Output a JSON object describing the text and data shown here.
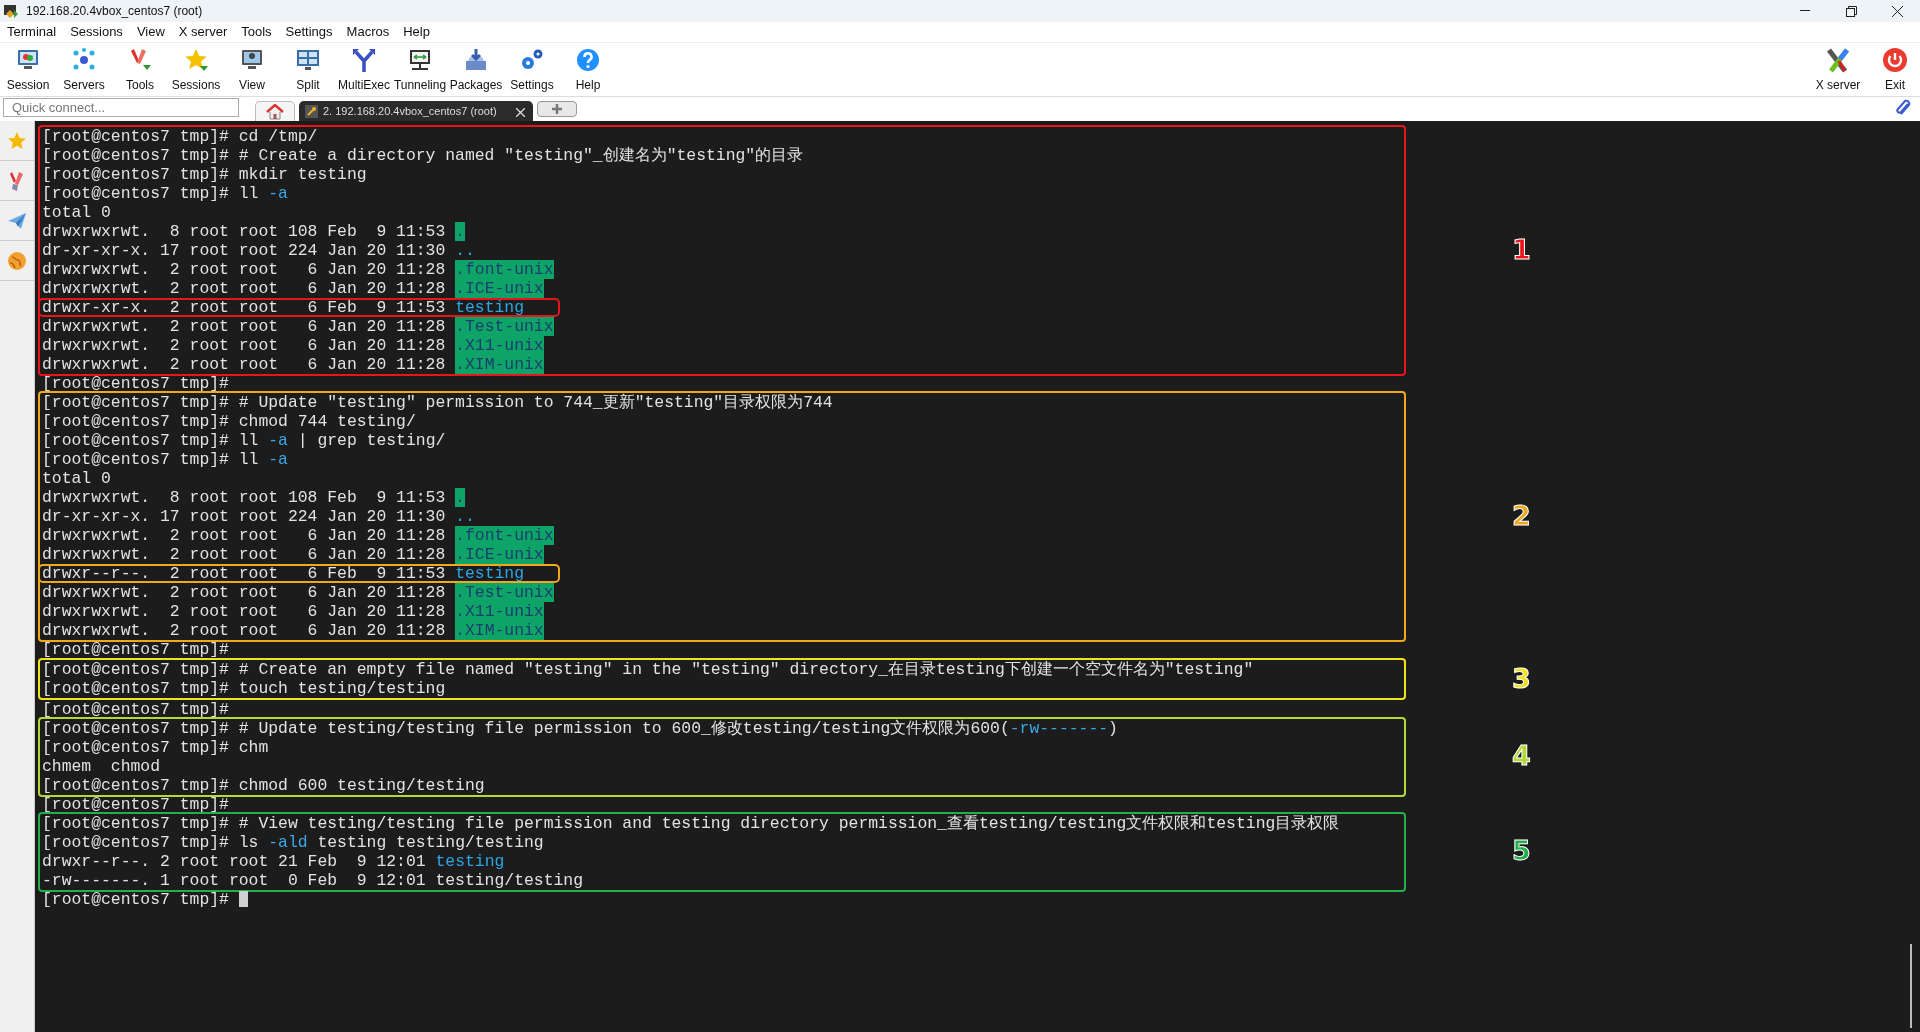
{
  "window": {
    "title": "192.168.20.4vbox_centos7 (root)"
  },
  "menu": [
    "Terminal",
    "Sessions",
    "View",
    "X server",
    "Tools",
    "Settings",
    "Macros",
    "Help"
  ],
  "toolbar": {
    "left": [
      "Session",
      "Servers",
      "Tools",
      "Sessions",
      "View",
      "Split",
      "MultiExec",
      "Tunneling",
      "Packages",
      "Settings",
      "Help"
    ],
    "right": [
      "X server",
      "Exit"
    ]
  },
  "quick_connect": {
    "placeholder": "Quick connect..."
  },
  "tabs": [
    {
      "kind": "home",
      "selected": false
    },
    {
      "kind": "session",
      "label": "2. 192.168.20.4vbox_centos7 (root)",
      "selected": true
    }
  ],
  "terminal": {
    "blocks": [
      {
        "box": {
          "color": "#e8161c",
          "number": "1"
        },
        "lines": [
          {
            "parts": [
              {
                "kind": "text",
                "text": "[root@centos7 tmp]# cd /tmp/"
              }
            ]
          },
          {
            "parts": [
              {
                "kind": "text",
                "text": "[root@centos7 tmp]# # Create a directory named \"testing\"_创建名为\"testing\"的目录"
              }
            ]
          },
          {
            "parts": [
              {
                "kind": "text",
                "text": "[root@centos7 tmp]# mkdir testing"
              }
            ]
          },
          {
            "parts": [
              {
                "kind": "text",
                "text": "[root@centos7 tmp]# ll "
              },
              {
                "kind": "option",
                "text": "-a"
              }
            ]
          },
          {
            "parts": [
              {
                "kind": "text",
                "text": "total 0"
              }
            ]
          },
          {
            "parts": [
              {
                "kind": "text",
                "text": "drwxrwxrwt.  8 root root 108 Feb  9 11:53 "
              },
              {
                "kind": "sticky",
                "text": "."
              }
            ]
          },
          {
            "parts": [
              {
                "kind": "text",
                "text": "dr-xr-xr-x. 17 root root 224 Jan 20 11:30 "
              },
              {
                "kind": "dir",
                "text": ".."
              }
            ]
          },
          {
            "parts": [
              {
                "kind": "text",
                "text": "drwxrwxrwt.  2 root root   6 Jan 20 11:28 "
              },
              {
                "kind": "sticky",
                "text": ".font-unix"
              }
            ]
          },
          {
            "parts": [
              {
                "kind": "text",
                "text": "drwxrwxrwt.  2 root root   6 Jan 20 11:28 "
              },
              {
                "kind": "sticky",
                "text": ".ICE-unix"
              }
            ]
          },
          {
            "highlight": true,
            "parts": [
              {
                "kind": "text",
                "text": "drwxr-xr-x.  2 root root   6 Feb  9 11:53 "
              },
              {
                "kind": "dir",
                "text": "testing"
              }
            ]
          },
          {
            "parts": [
              {
                "kind": "text",
                "text": "drwxrwxrwt.  2 root root   6 Jan 20 11:28 "
              },
              {
                "kind": "sticky",
                "text": ".Test-unix"
              }
            ]
          },
          {
            "parts": [
              {
                "kind": "text",
                "text": "drwxrwxrwt.  2 root root   6 Jan 20 11:28 "
              },
              {
                "kind": "sticky",
                "text": ".X11-unix"
              }
            ]
          },
          {
            "parts": [
              {
                "kind": "text",
                "text": "drwxrwxrwt.  2 root root   6 Jan 20 11:28 "
              },
              {
                "kind": "sticky",
                "text": ".XIM-unix"
              }
            ]
          }
        ]
      },
      {
        "lines": [
          {
            "parts": [
              {
                "kind": "text",
                "text": "[root@centos7 tmp]#"
              }
            ]
          }
        ]
      },
      {
        "box": {
          "color": "#f0a81c",
          "number": "2"
        },
        "lines": [
          {
            "parts": [
              {
                "kind": "text",
                "text": "[root@centos7 tmp]# # Update \"testing\" permission to 744_更新\"testing\"目录权限为744"
              }
            ]
          },
          {
            "parts": [
              {
                "kind": "text",
                "text": "[root@centos7 tmp]# chmod 744 testing/"
              }
            ]
          },
          {
            "parts": [
              {
                "kind": "text",
                "text": "[root@centos7 tmp]# ll "
              },
              {
                "kind": "option",
                "text": "-a"
              },
              {
                "kind": "text",
                "text": " | grep testing/"
              }
            ]
          },
          {
            "parts": [
              {
                "kind": "text",
                "text": "[root@centos7 tmp]# ll "
              },
              {
                "kind": "option",
                "text": "-a"
              }
            ]
          },
          {
            "parts": [
              {
                "kind": "text",
                "text": "total 0"
              }
            ]
          },
          {
            "parts": [
              {
                "kind": "text",
                "text": "drwxrwxrwt.  8 root root 108 Feb  9 11:53 "
              },
              {
                "kind": "sticky",
                "text": "."
              }
            ]
          },
          {
            "parts": [
              {
                "kind": "text",
                "text": "dr-xr-xr-x. 17 root root 224 Jan 20 11:30 "
              },
              {
                "kind": "dir",
                "text": ".."
              }
            ]
          },
          {
            "parts": [
              {
                "kind": "text",
                "text": "drwxrwxrwt.  2 root root   6 Jan 20 11:28 "
              },
              {
                "kind": "sticky",
                "text": ".font-unix"
              }
            ]
          },
          {
            "parts": [
              {
                "kind": "text",
                "text": "drwxrwxrwt.  2 root root   6 Jan 20 11:28 "
              },
              {
                "kind": "sticky",
                "text": ".ICE-unix"
              }
            ]
          },
          {
            "highlight": true,
            "parts": [
              {
                "kind": "text",
                "text": "drwxr--r--.  2 root root   6 Feb  9 11:53 "
              },
              {
                "kind": "dir",
                "text": "testing"
              }
            ]
          },
          {
            "parts": [
              {
                "kind": "text",
                "text": "drwxrwxrwt.  2 root root   6 Jan 20 11:28 "
              },
              {
                "kind": "sticky",
                "text": ".Test-unix"
              }
            ]
          },
          {
            "parts": [
              {
                "kind": "text",
                "text": "drwxrwxrwt.  2 root root   6 Jan 20 11:28 "
              },
              {
                "kind": "sticky",
                "text": ".X11-unix"
              }
            ]
          },
          {
            "parts": [
              {
                "kind": "text",
                "text": "drwxrwxrwt.  2 root root   6 Jan 20 11:28 "
              },
              {
                "kind": "sticky",
                "text": ".XIM-unix"
              }
            ]
          }
        ]
      },
      {
        "lines": [
          {
            "parts": [
              {
                "kind": "text",
                "text": "[root@centos7 tmp]#"
              }
            ]
          }
        ]
      },
      {
        "box": {
          "color": "#f2e21a",
          "number": "3"
        },
        "lines": [
          {
            "parts": [
              {
                "kind": "text",
                "text": "[root@centos7 tmp]# # Create an empty file named \"testing\" in the \"testing\" directory_在目录testing下创建一个空文件名为\"testing\""
              }
            ]
          },
          {
            "parts": [
              {
                "kind": "text",
                "text": "[root@centos7 tmp]# touch testing/testing"
              }
            ]
          }
        ]
      },
      {
        "lines": [
          {
            "parts": [
              {
                "kind": "text",
                "text": "[root@centos7 tmp]#"
              }
            ]
          }
        ]
      },
      {
        "box": {
          "color": "#b4d836",
          "number": "4"
        },
        "lines": [
          {
            "parts": [
              {
                "kind": "text",
                "text": "[root@centos7 tmp]# # Update testing/testing file permission to 600_修改testing/testing文件权限为600("
              },
              {
                "kind": "option",
                "text": "-rw-------"
              },
              {
                "kind": "text",
                "text": ")"
              }
            ]
          },
          {
            "parts": [
              {
                "kind": "text",
                "text": "[root@centos7 tmp]# chm"
              }
            ]
          },
          {
            "parts": [
              {
                "kind": "text",
                "text": "chmem  chmod"
              }
            ]
          },
          {
            "parts": [
              {
                "kind": "text",
                "text": "[root@centos7 tmp]# chmod 600 testing/testing"
              }
            ]
          }
        ]
      },
      {
        "lines": [
          {
            "parts": [
              {
                "kind": "text",
                "text": "[root@centos7 tmp]#"
              }
            ]
          }
        ]
      },
      {
        "box": {
          "color": "#22b048",
          "number": "5"
        },
        "lines": [
          {
            "parts": [
              {
                "kind": "text",
                "text": "[root@centos7 tmp]# # View testing/testing file permission and testing directory permission_查看testing/testing文件权限和testing目录权限"
              }
            ]
          },
          {
            "parts": [
              {
                "kind": "text",
                "text": "[root@centos7 tmp]# ls "
              },
              {
                "kind": "option",
                "text": "-ald"
              },
              {
                "kind": "text",
                "text": " testing testing/testing"
              }
            ]
          },
          {
            "parts": [
              {
                "kind": "text",
                "text": "drwxr--r--. 2 root root 21 Feb  9 12:01 "
              },
              {
                "kind": "dir",
                "text": "testing"
              }
            ]
          },
          {
            "parts": [
              {
                "kind": "text",
                "text": "-rw-------. 1 root root  0 Feb  9 12:01 testing/testing"
              }
            ]
          }
        ]
      },
      {
        "lines": [
          {
            "cursor": true,
            "parts": [
              {
                "kind": "text",
                "text": "[root@centos7 tmp]# "
              }
            ]
          }
        ]
      }
    ]
  }
}
